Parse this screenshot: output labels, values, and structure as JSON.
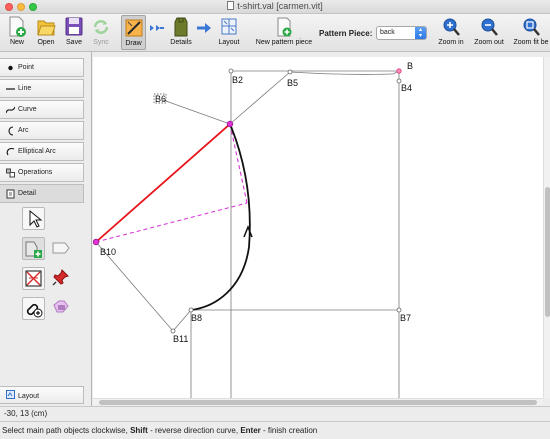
{
  "window": {
    "title": "t-shirt.val [carmen.vit]"
  },
  "toolbar": {
    "new": "New",
    "open": "Open",
    "save": "Save",
    "sync": "Sync",
    "draw": "Draw",
    "details": "Details",
    "layout": "Layout",
    "new_pattern_piece": "New pattern piece",
    "pattern_piece_label": "Pattern Piece:",
    "pattern_piece_value": "back",
    "zoom_in": "Zoom in",
    "zoom_out": "Zoom out",
    "zoom_fit": "Zoom fit be"
  },
  "tools": {
    "categories": [
      "Point",
      "Line",
      "Curve",
      "Arc",
      "Elliptical Arc",
      "Operations",
      "Detail"
    ],
    "selected_category": "Detail",
    "bottom_category": "Layout"
  },
  "canvas": {
    "labels": {
      "b": "B",
      "b2": "B2",
      "b4": "B4",
      "b5": "B5",
      "b6": "B6",
      "b7": "B7",
      "b8": "B8",
      "b10": "B10",
      "b11": "B11"
    },
    "colors": {
      "selected_line": "#e8141a",
      "dashed_path": "#d633d6",
      "point_highlight": "#e033d6",
      "construction_line": "#7c7c7c",
      "curve": "#111111"
    }
  },
  "status": {
    "coordinates": "-30, 13 (cm)",
    "hint_prefix": "Select main path objects clockwise, ",
    "hint_key1": "Shift",
    "hint_mid": " - reverse direction curve, ",
    "hint_key2": "Enter",
    "hint_suffix": " - finish creation"
  }
}
